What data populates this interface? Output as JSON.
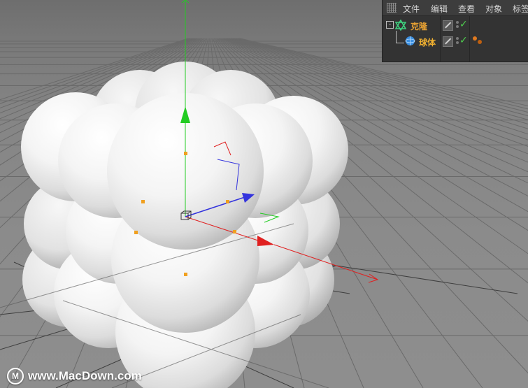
{
  "object_manager": {
    "menu": [
      "文件",
      "编辑",
      "查看",
      "对象",
      "标签"
    ],
    "objects": [
      {
        "name": "克隆",
        "icon": "cloner-icon",
        "name_color": "#e9a233"
      },
      {
        "name": "球体",
        "icon": "sphere-icon",
        "name_color": "#f0b030"
      }
    ],
    "colors": {
      "panel": "#333333",
      "check": "#4fd14f",
      "selected_name": "#e9a233"
    }
  },
  "viewport": {
    "axis_colors": {
      "x": "#e02020",
      "y": "#22cc22",
      "z": "#3333dd"
    },
    "handle_color": "#f0a020"
  },
  "watermark": {
    "logo": "M",
    "text": "www.MacDown.com"
  }
}
